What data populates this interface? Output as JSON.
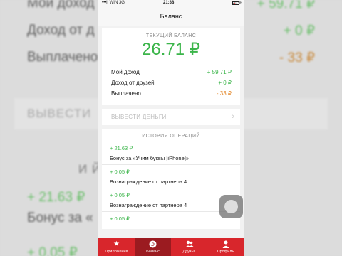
{
  "status_bar": {
    "carrier": "•••ll WIN  3G",
    "time": "21:38",
    "battery": "20 %"
  },
  "navbar": {
    "title": "Баланс"
  },
  "balance": {
    "title": "ТЕКУЩИЙ БАЛАНС",
    "amount": "26.71 ₽",
    "rows": [
      {
        "label": "Мой доход",
        "value": "+ 59.71 ₽"
      },
      {
        "label": "Доход от друзей",
        "value": "+ 0 ₽"
      },
      {
        "label": "Выплачено",
        "value": "- 33 ₽"
      }
    ]
  },
  "withdraw": {
    "label": "ВЫВЕСТИ ДЕНЬГИ"
  },
  "history": {
    "title": "ИСТОРИЯ ОПЕРАЦИЙ",
    "items": [
      {
        "amount": "+ 21.63 ₽",
        "description": "Бонус за «Учим буквы [iPhone]»"
      },
      {
        "amount": "+ 0.05 ₽",
        "description": "Вознаграждение от партнера 4"
      },
      {
        "amount": "+ 0.05 ₽",
        "description": "Вознаграждение от партнера 4"
      },
      {
        "amount": "+ 0.05 ₽",
        "description": ""
      }
    ]
  },
  "tabbar": {
    "items": [
      {
        "label": "Приложения",
        "icon": "star-icon"
      },
      {
        "label": "Баланс",
        "icon": "ruble-icon",
        "active": true
      },
      {
        "label": "Друзья",
        "icon": "friends-icon"
      },
      {
        "label": "Профиль",
        "icon": "person-icon"
      }
    ]
  },
  "background": {
    "row1_label": "Мой доход",
    "row1_value": "+ 59.71 ₽",
    "row2_label": "Доход от д",
    "row2_value": "+ 0 ₽",
    "row3_label": "Выплачено",
    "row3_value": "- 33 ₽",
    "bar_text": "ВЫВЕСТИ",
    "history_text": "И                              Й",
    "op1_amount": "+ 21.63 ₽",
    "op1_desc": "Бонус за «",
    "op2_amount": "+ 0.05 ₽"
  },
  "colors": {
    "accent_red": "#d8262c",
    "positive_green": "#3bb54a",
    "payout_orange": "#e38525"
  }
}
